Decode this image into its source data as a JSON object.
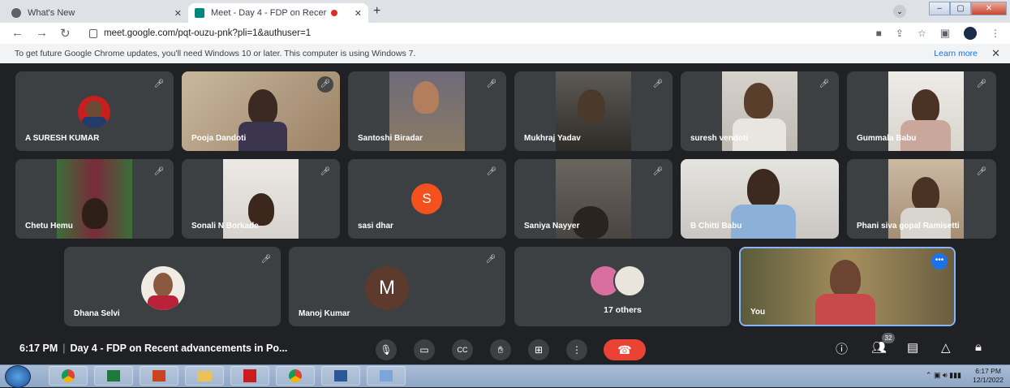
{
  "browser": {
    "tabs": [
      {
        "title": "What's New",
        "active": false
      },
      {
        "title": "Meet - Day 4 - FDP on Recer",
        "active": true
      }
    ],
    "url": "meet.google.com/pqt-ouzu-pnk?pli=1&authuser=1"
  },
  "infobar": {
    "message": "To get future Google Chrome updates, you'll need Windows 10 or later. This computer is using Windows 7.",
    "learn_more": "Learn more",
    "close": "✕"
  },
  "participants": [
    {
      "name": "A SURESH KUMAR",
      "muted": true
    },
    {
      "name": "Pooja Dandoti",
      "muted": true
    },
    {
      "name": "Santoshi Biradar",
      "muted": true
    },
    {
      "name": "Mukhraj Yadav",
      "muted": true
    },
    {
      "name": "suresh vendoti",
      "muted": true
    },
    {
      "name": "Gummala Babu",
      "muted": true
    },
    {
      "name": "Chetu Hemu",
      "muted": true
    },
    {
      "name": "Sonali N Borkade",
      "muted": true
    },
    {
      "name": "sasi dhar",
      "muted": true,
      "initial": "S",
      "avatar_color": "#f4511e"
    },
    {
      "name": "Saniya Nayyer",
      "muted": true
    },
    {
      "name": "B Chitti Babu",
      "muted": false
    },
    {
      "name": "Phani siva gopal Ramisetti",
      "muted": true
    },
    {
      "name": "Dhana Selvi",
      "muted": true
    },
    {
      "name": "Manoj Kumar",
      "muted": true,
      "initial": "M",
      "avatar_color": "#5d3a2e"
    },
    {
      "name": "17 others",
      "muted": false
    },
    {
      "name": "You",
      "muted": false
    }
  ],
  "meeting": {
    "time": "6:17 PM",
    "title": "Day 4 - FDP on Recent advancements in Po...",
    "participant_count": "32"
  },
  "taskbar": {
    "clock_time": "6:17 PM",
    "clock_date": "12/1/2022"
  },
  "icons": {
    "mic": "mic-icon",
    "camera": "camera-icon",
    "captions": "captions-icon",
    "hand": "raise-hand-icon",
    "present": "present-icon",
    "more": "more-icon",
    "end": "end-call-icon"
  },
  "colors": {
    "meet_bg": "#202124",
    "tile_bg": "#3c4043",
    "end_call": "#ea4335",
    "blue_border": "#4285f4"
  }
}
